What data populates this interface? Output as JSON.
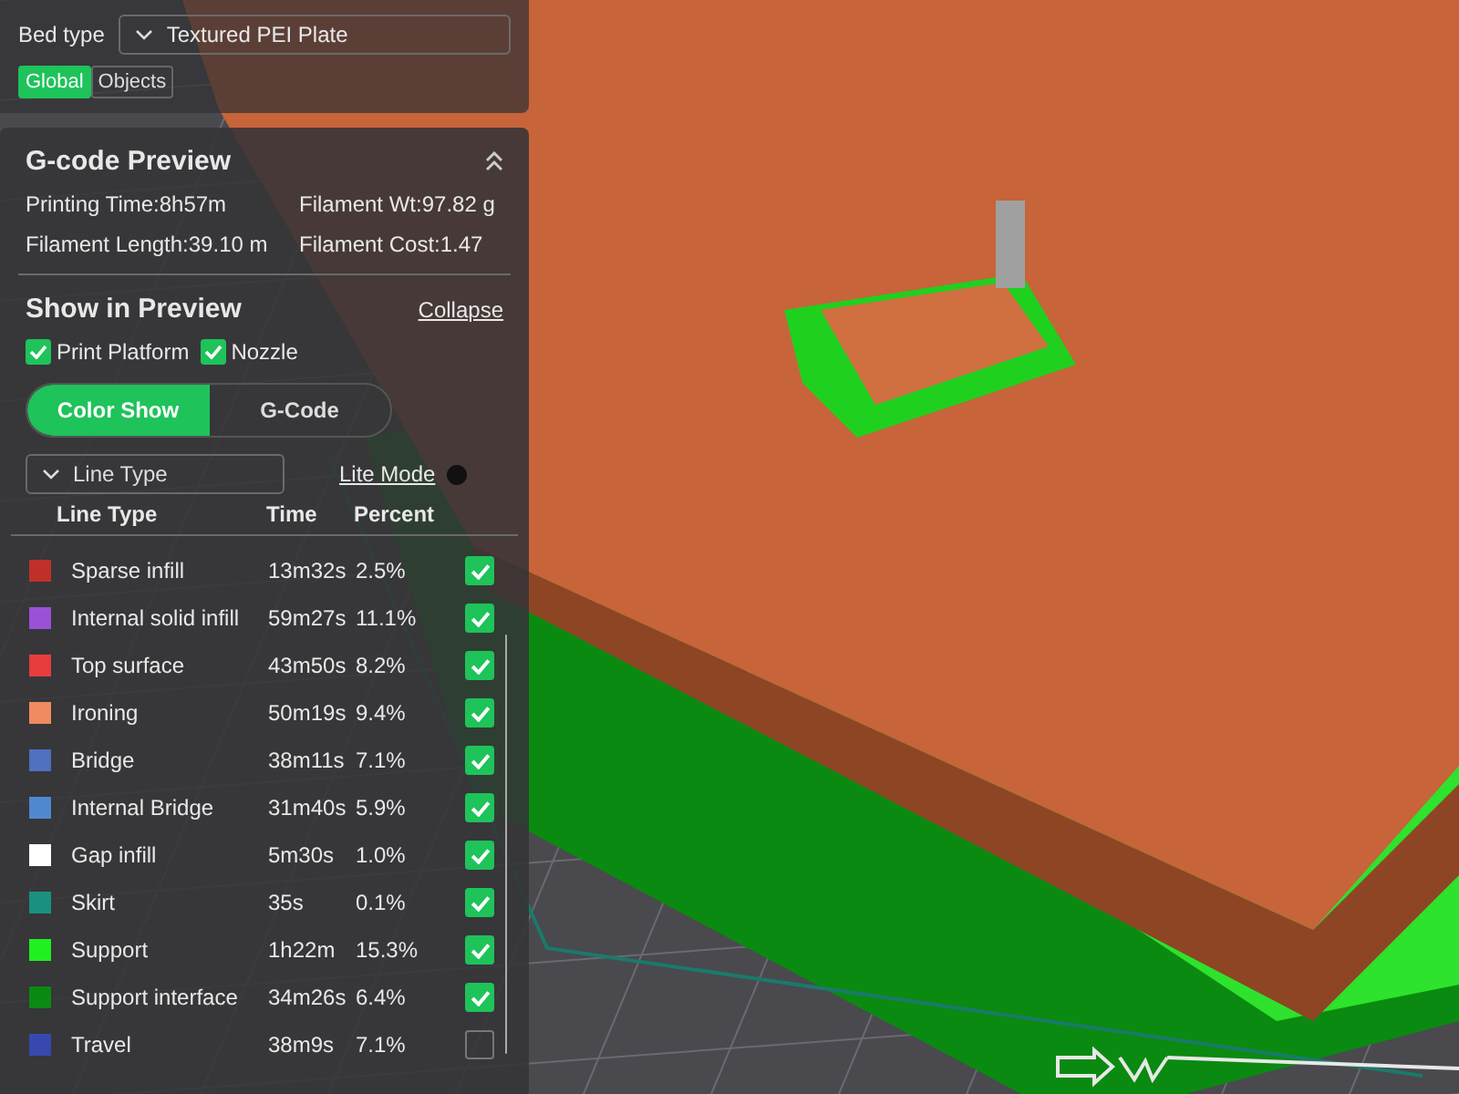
{
  "bed_type": {
    "label": "Bed type",
    "value": "Textured PEI Plate"
  },
  "scope_tabs": [
    {
      "label": "Global",
      "selected": true
    },
    {
      "label": "Objects",
      "selected": false
    }
  ],
  "gcode_preview": {
    "title": "G-code Preview",
    "expanded": true,
    "stats": [
      {
        "label": "Printing Time:8h57m"
      },
      {
        "label": "Filament Wt:97.82 g"
      },
      {
        "label": "Filament Length:39.10 m"
      },
      {
        "label": "Filament Cost:1.47"
      }
    ],
    "show_in_preview": {
      "title": "Show in Preview",
      "link": "Collapse",
      "options": [
        {
          "label": "Print Platform",
          "checked": true
        },
        {
          "label": "Nozzle",
          "checked": true
        }
      ]
    },
    "view_tabs": [
      {
        "label": "Color Show",
        "selected": true
      },
      {
        "label": "G-Code",
        "selected": false
      }
    ],
    "view_dropdown": {
      "value": "Line Type"
    },
    "lite_mode": {
      "label": "Lite Mode",
      "on": false
    },
    "table": {
      "columns": [
        "Line Type",
        "Time",
        "Percent"
      ],
      "rows": [
        {
          "name": "Sparse infill",
          "time": "13m32s",
          "percent": "2.5%",
          "color": "#c0302a",
          "checked": true
        },
        {
          "name": "Internal solid infill",
          "time": "59m27s",
          "percent": "11.1%",
          "color": "#9b50d8",
          "checked": true
        },
        {
          "name": "Top surface",
          "time": "43m50s",
          "percent": "8.2%",
          "color": "#e83c3c",
          "checked": true
        },
        {
          "name": "Ironing",
          "time": "50m19s",
          "percent": "9.4%",
          "color": "#f08a60",
          "checked": true
        },
        {
          "name": "Bridge",
          "time": "38m11s",
          "percent": "7.1%",
          "color": "#5070c0",
          "checked": true
        },
        {
          "name": "Internal Bridge",
          "time": "31m40s",
          "percent": "5.9%",
          "color": "#5088d0",
          "checked": true
        },
        {
          "name": "Gap infill",
          "time": "5m30s",
          "percent": "1.0%",
          "color": "#ffffff",
          "checked": true
        },
        {
          "name": "Skirt",
          "time": "35s",
          "percent": "0.1%",
          "color": "#1a9080",
          "checked": true
        },
        {
          "name": "Support",
          "time": "1h22m",
          "percent": "15.3%",
          "color": "#20f020",
          "checked": true
        },
        {
          "name": "Support interface",
          "time": "34m26s",
          "percent": "6.4%",
          "color": "#0a8a10",
          "checked": true
        },
        {
          "name": "Travel",
          "time": "38m9s",
          "percent": "7.1%",
          "color": "#3848b0",
          "checked": false
        }
      ]
    }
  }
}
